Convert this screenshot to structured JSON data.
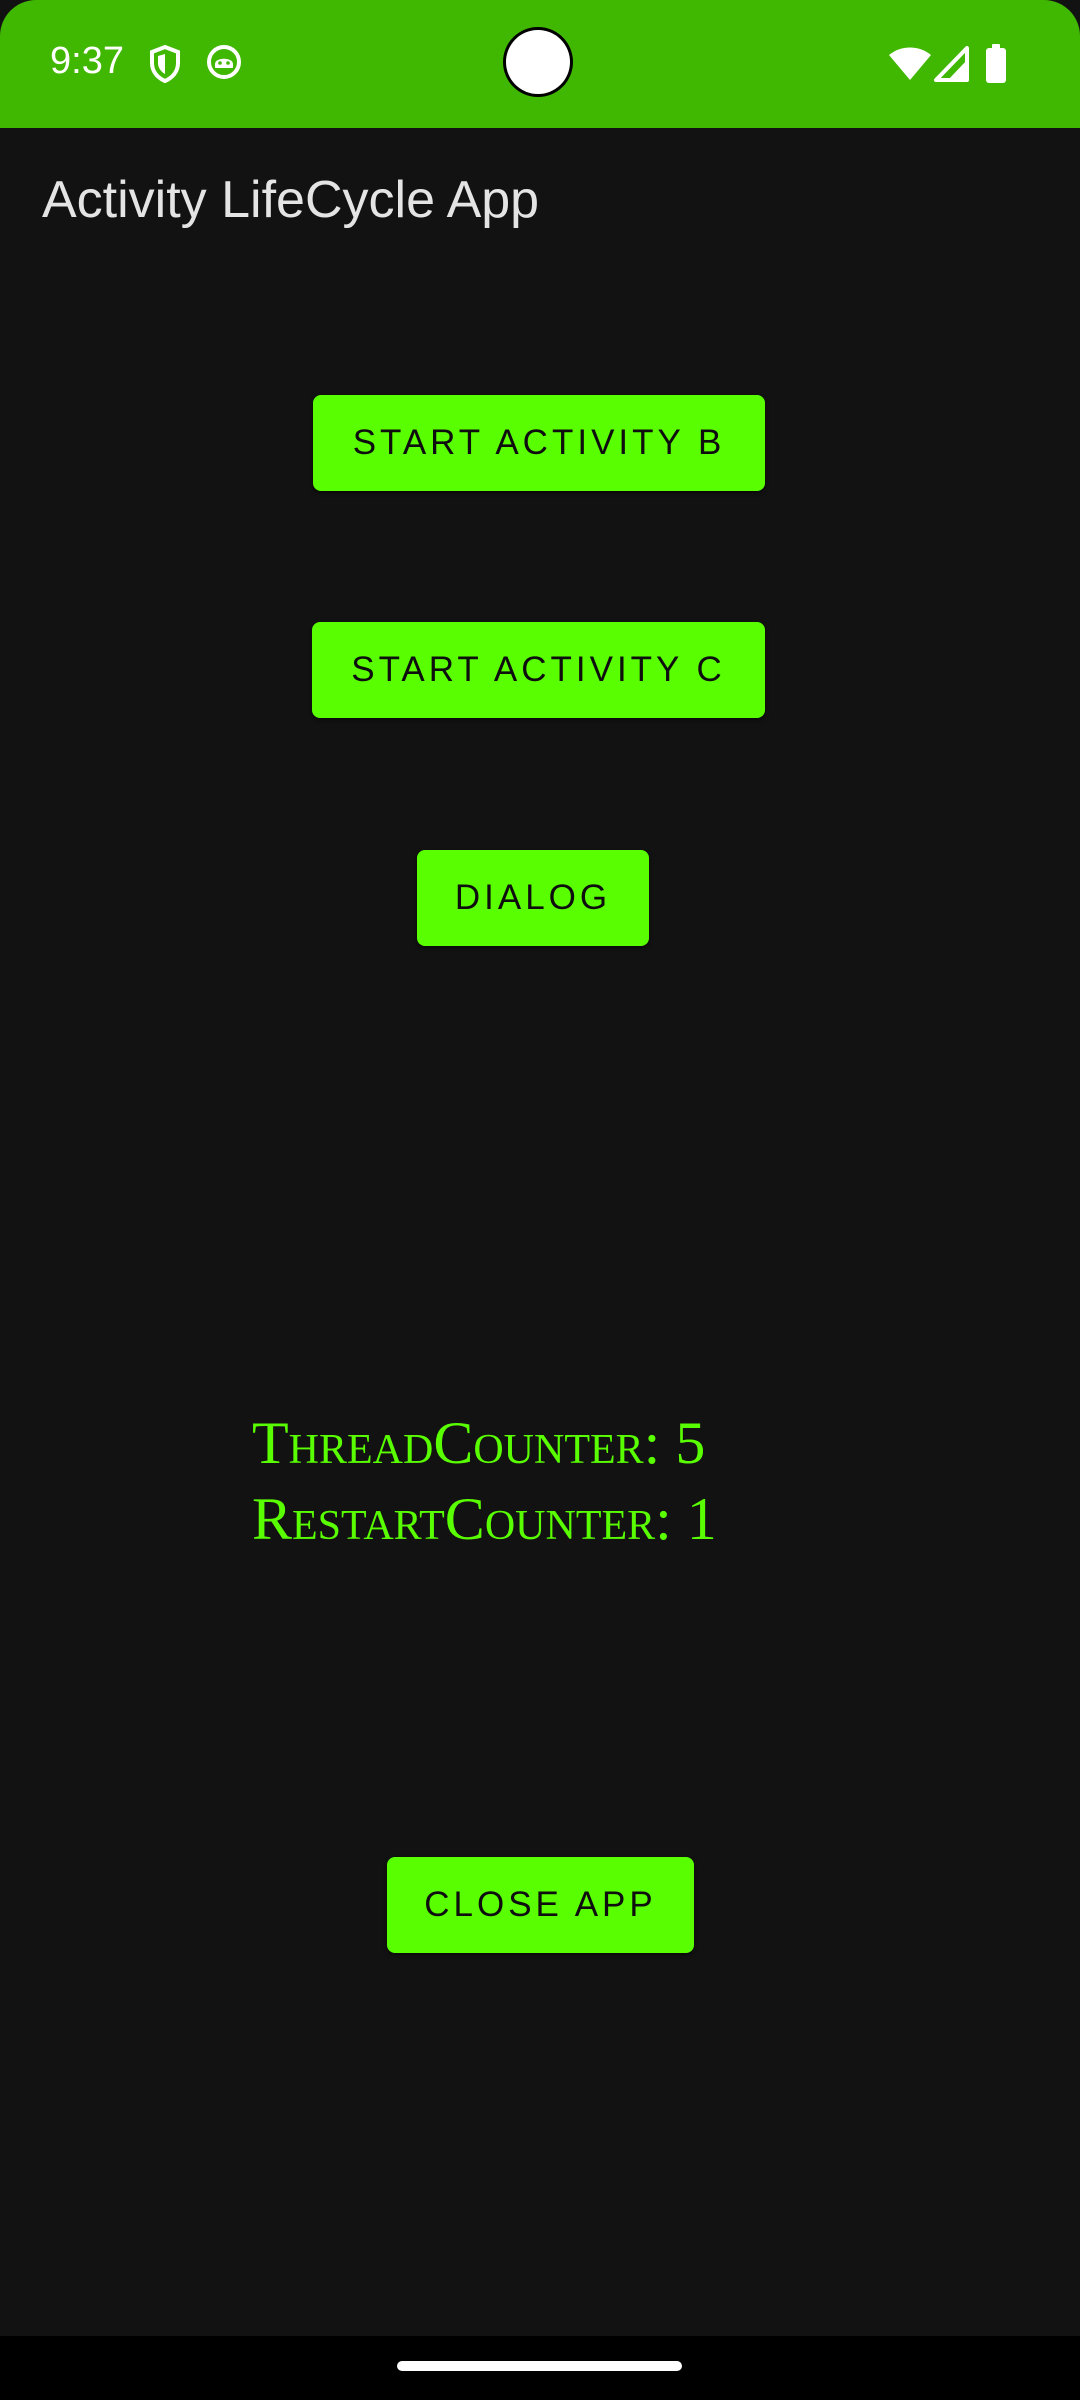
{
  "status_bar": {
    "time": "9:37",
    "left_icons": [
      "shield-icon",
      "android-face-icon"
    ],
    "right_icons": [
      "wifi-icon",
      "cellular-signal-icon",
      "battery-icon"
    ],
    "color": "#40b700"
  },
  "app": {
    "title": "Activity LifeCycle App",
    "accent_color": "#59ff00",
    "background_color": "#121212"
  },
  "buttons": {
    "start_activity_b": "START ACTIVITY B",
    "start_activity_c": "START ACTIVITY C",
    "dialog": "DIALOG",
    "close_app": "CLOSE APP"
  },
  "counters": {
    "thread_counter": "ThreadCounter: 5",
    "restart_counter": "RestartCounter: 1"
  }
}
